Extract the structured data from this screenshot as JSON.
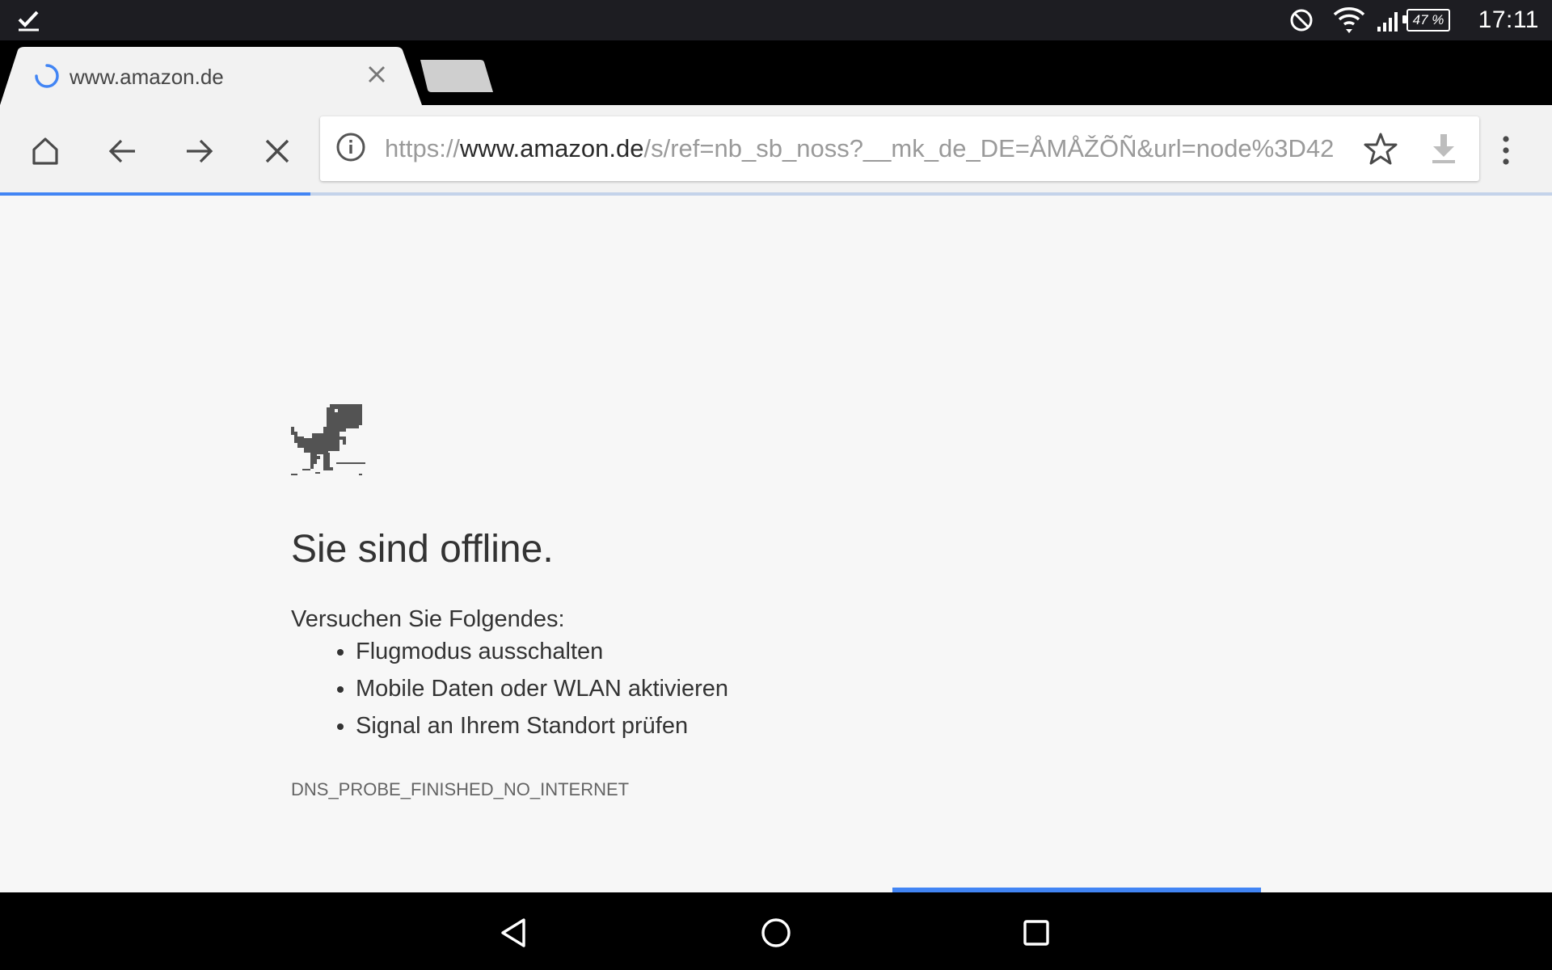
{
  "status_bar": {
    "clock": "17:11",
    "battery": "47 %",
    "icons": [
      "checkmark-notification-icon",
      "do-not-disturb-icon",
      "wifi-icon",
      "cellular-signal-icon",
      "battery-icon"
    ]
  },
  "tabs": {
    "active": {
      "title": "www.amazon.de",
      "loading": true
    },
    "new_tab": {
      "icon": "new-tab-icon"
    }
  },
  "toolbar": {
    "icons": [
      "home-icon",
      "back-arrow-icon",
      "forward-arrow-icon",
      "stop-loading-icon",
      "info-icon",
      "star-icon",
      "download-icon",
      "overflow-menu-icon"
    ],
    "url": {
      "scheme": "https://",
      "host": "www.amazon.de",
      "path": "/s/ref=nb_sb_noss?__mk_de_DE=ÅMÅŽÕÑ&url=node%3D42"
    },
    "load_progress": 0.2
  },
  "error_page": {
    "headline": "Sie sind offline.",
    "suggestions_heading": "Versuchen Sie Folgendes:",
    "suggestions": [
      "Flugmodus ausschalten",
      "Mobile Daten oder WLAN aktivieren",
      "Signal an Ihrem Standort prüfen"
    ],
    "error_code": "DNS_PROBE_FINISHED_NO_INTERNET"
  },
  "nav_bar": {
    "icons": [
      "back-triangle-icon",
      "home-circle-icon",
      "recents-square-icon"
    ]
  },
  "colors": {
    "accent": "#4285f4",
    "status_bar": "#1d1d22",
    "toolbar": "#f2f2f2",
    "page_background": "#f7f7f7",
    "text": "#333333"
  }
}
